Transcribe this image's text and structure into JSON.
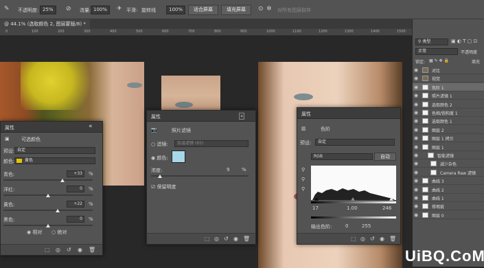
{
  "options_bar": {
    "opacity_label": "不透明度:",
    "opacity_value": "25%",
    "flow_label": "流量:",
    "flow_value": "100%",
    "smooth_label": "平滑:",
    "smooth_value": "旋转线",
    "zoom_value": "100%",
    "fit_screen": "适合屏幕",
    "fill_screen": "填充屏幕",
    "sample_all": "对所有图层取样"
  },
  "doc_tab": {
    "title": "@ 44.1% (选取颜色 2, 图层蒙版/8) *"
  },
  "ruler": {
    "ticks": [
      "0",
      "100",
      "200",
      "300",
      "400",
      "500",
      "600",
      "700",
      "800",
      "900",
      "1000",
      "1100",
      "1200",
      "1300",
      "1400",
      "1500"
    ]
  },
  "selective_color": {
    "title": "属性",
    "name": "可选颜色",
    "preset_label": "预设:",
    "preset_value": "自定",
    "colors_label": "颜色:",
    "colors_value": "黄色",
    "rows": [
      {
        "label": "青色:",
        "value": "+33",
        "unit": "%",
        "level": 0.66
      },
      {
        "label": "洋红:",
        "value": "0",
        "unit": "%",
        "level": 0.5
      },
      {
        "label": "黄色:",
        "value": "+22",
        "unit": "%",
        "level": 0.61
      },
      {
        "label": "黑色:",
        "value": "0",
        "unit": "%",
        "level": 0.5
      }
    ],
    "relative": "相对",
    "absolute": "绝对"
  },
  "photo_filter": {
    "title": "属性",
    "name": "照片滤镜",
    "filter_label": "滤镜:",
    "filter_value": "加温滤镜 (85)",
    "color_label": "颜色:",
    "density_label": "浓度:",
    "density_value": "9",
    "density_unit": "%",
    "density_level": 0.09,
    "preserve_label": "保留明度",
    "swatch": "#a8d8e8"
  },
  "levels": {
    "title": "属性",
    "name": "色阶",
    "preset_label": "预设:",
    "preset_value": "自定",
    "channel": "RGB",
    "auto": "自动",
    "input_black": "17",
    "input_mid": "1.00",
    "input_white": "246",
    "output_label": "输出色阶:",
    "output_black": "0",
    "output_white": "255"
  },
  "layers_panel": {
    "kind_label": "类型",
    "blend_mode": "正常",
    "opacity_label": "不透明度",
    "lock_label": "锁定:",
    "fill_label": "填充",
    "layers": [
      {
        "name": "对比"
      },
      {
        "name": "视觉"
      },
      {
        "name": "色阶 1"
      },
      {
        "name": "照片滤镜 1"
      },
      {
        "name": "选取颜色 2"
      },
      {
        "name": "色相/饱和度 1"
      },
      {
        "name": "选取颜色 1"
      },
      {
        "name": "图层 2"
      },
      {
        "name": "图层 1 拷贝"
      },
      {
        "name": "图层 1"
      },
      {
        "name": "智能滤镜"
      },
      {
        "name": "减少杂色"
      },
      {
        "name": "Camera Raw 滤镜"
      },
      {
        "name": "曲线 3"
      },
      {
        "name": "曲线 2"
      },
      {
        "name": "曲线 1"
      },
      {
        "name": "修瑕疵"
      },
      {
        "name": "图层 0"
      }
    ]
  },
  "watermark": "UiBQ.CoM"
}
